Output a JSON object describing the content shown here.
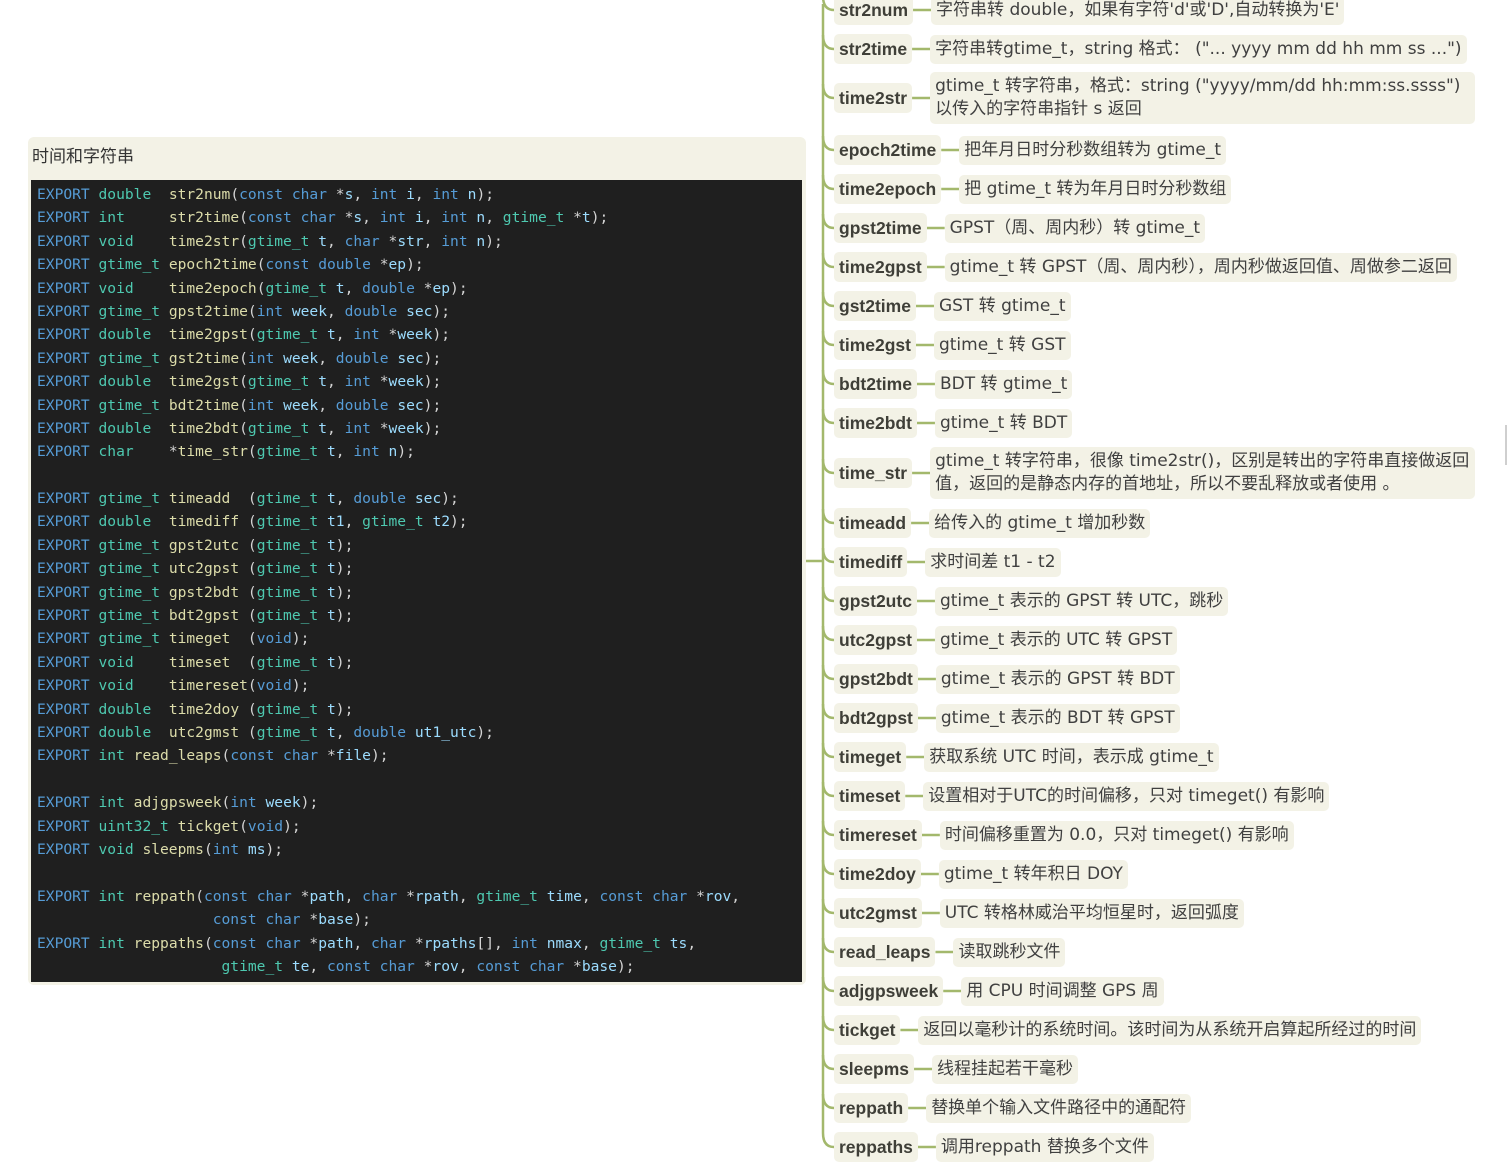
{
  "topic": {
    "title": "时间和字符串",
    "code_lines": [
      [
        [
          "kw",
          "EXPORT "
        ],
        [
          "ty",
          "double  "
        ],
        [
          "fn",
          "str2num"
        ],
        [
          "pu",
          "("
        ],
        [
          "kw",
          "const char "
        ],
        [
          "pu",
          "*"
        ],
        [
          "pa",
          "s"
        ],
        [
          "pu",
          ", "
        ],
        [
          "kw",
          "int "
        ],
        [
          "pa",
          "i"
        ],
        [
          "pu",
          ", "
        ],
        [
          "kw",
          "int "
        ],
        [
          "pa",
          "n"
        ],
        [
          "pu",
          ");"
        ]
      ],
      [
        [
          "kw",
          "EXPORT "
        ],
        [
          "ty",
          "int     "
        ],
        [
          "fn",
          "str2time"
        ],
        [
          "pu",
          "("
        ],
        [
          "kw",
          "const char "
        ],
        [
          "pu",
          "*"
        ],
        [
          "pa",
          "s"
        ],
        [
          "pu",
          ", "
        ],
        [
          "kw",
          "int "
        ],
        [
          "pa",
          "i"
        ],
        [
          "pu",
          ", "
        ],
        [
          "kw",
          "int "
        ],
        [
          "pa",
          "n"
        ],
        [
          "pu",
          ", "
        ],
        [
          "ty",
          "gtime_t "
        ],
        [
          "pu",
          "*"
        ],
        [
          "pa",
          "t"
        ],
        [
          "pu",
          ");"
        ]
      ],
      [
        [
          "kw",
          "EXPORT "
        ],
        [
          "ty",
          "void    "
        ],
        [
          "fn",
          "time2str"
        ],
        [
          "pu",
          "("
        ],
        [
          "ty",
          "gtime_t "
        ],
        [
          "pa",
          "t"
        ],
        [
          "pu",
          ", "
        ],
        [
          "kw",
          "char "
        ],
        [
          "pu",
          "*"
        ],
        [
          "pa",
          "str"
        ],
        [
          "pu",
          ", "
        ],
        [
          "kw",
          "int "
        ],
        [
          "pa",
          "n"
        ],
        [
          "pu",
          ");"
        ]
      ],
      [
        [
          "kw",
          "EXPORT "
        ],
        [
          "ty",
          "gtime_t "
        ],
        [
          "fn",
          "epoch2time"
        ],
        [
          "pu",
          "("
        ],
        [
          "kw",
          "const double "
        ],
        [
          "pu",
          "*"
        ],
        [
          "pa",
          "ep"
        ],
        [
          "pu",
          ");"
        ]
      ],
      [
        [
          "kw",
          "EXPORT "
        ],
        [
          "ty",
          "void    "
        ],
        [
          "fn",
          "time2epoch"
        ],
        [
          "pu",
          "("
        ],
        [
          "ty",
          "gtime_t "
        ],
        [
          "pa",
          "t"
        ],
        [
          "pu",
          ", "
        ],
        [
          "kw",
          "double "
        ],
        [
          "pu",
          "*"
        ],
        [
          "pa",
          "ep"
        ],
        [
          "pu",
          ");"
        ]
      ],
      [
        [
          "kw",
          "EXPORT "
        ],
        [
          "ty",
          "gtime_t "
        ],
        [
          "fn",
          "gpst2time"
        ],
        [
          "pu",
          "("
        ],
        [
          "kw",
          "int "
        ],
        [
          "pa",
          "week"
        ],
        [
          "pu",
          ", "
        ],
        [
          "kw",
          "double "
        ],
        [
          "pa",
          "sec"
        ],
        [
          "pu",
          ");"
        ]
      ],
      [
        [
          "kw",
          "EXPORT "
        ],
        [
          "ty",
          "double  "
        ],
        [
          "fn",
          "time2gpst"
        ],
        [
          "pu",
          "("
        ],
        [
          "ty",
          "gtime_t "
        ],
        [
          "pa",
          "t"
        ],
        [
          "pu",
          ", "
        ],
        [
          "kw",
          "int "
        ],
        [
          "pu",
          "*"
        ],
        [
          "pa",
          "week"
        ],
        [
          "pu",
          ");"
        ]
      ],
      [
        [
          "kw",
          "EXPORT "
        ],
        [
          "ty",
          "gtime_t "
        ],
        [
          "fn",
          "gst2time"
        ],
        [
          "pu",
          "("
        ],
        [
          "kw",
          "int "
        ],
        [
          "pa",
          "week"
        ],
        [
          "pu",
          ", "
        ],
        [
          "kw",
          "double "
        ],
        [
          "pa",
          "sec"
        ],
        [
          "pu",
          ");"
        ]
      ],
      [
        [
          "kw",
          "EXPORT "
        ],
        [
          "ty",
          "double  "
        ],
        [
          "fn",
          "time2gst"
        ],
        [
          "pu",
          "("
        ],
        [
          "ty",
          "gtime_t "
        ],
        [
          "pa",
          "t"
        ],
        [
          "pu",
          ", "
        ],
        [
          "kw",
          "int "
        ],
        [
          "pu",
          "*"
        ],
        [
          "pa",
          "week"
        ],
        [
          "pu",
          ");"
        ]
      ],
      [
        [
          "kw",
          "EXPORT "
        ],
        [
          "ty",
          "gtime_t "
        ],
        [
          "fn",
          "bdt2time"
        ],
        [
          "pu",
          "("
        ],
        [
          "kw",
          "int "
        ],
        [
          "pa",
          "week"
        ],
        [
          "pu",
          ", "
        ],
        [
          "kw",
          "double "
        ],
        [
          "pa",
          "sec"
        ],
        [
          "pu",
          ");"
        ]
      ],
      [
        [
          "kw",
          "EXPORT "
        ],
        [
          "ty",
          "double  "
        ],
        [
          "fn",
          "time2bdt"
        ],
        [
          "pu",
          "("
        ],
        [
          "ty",
          "gtime_t "
        ],
        [
          "pa",
          "t"
        ],
        [
          "pu",
          ", "
        ],
        [
          "kw",
          "int "
        ],
        [
          "pu",
          "*"
        ],
        [
          "pa",
          "week"
        ],
        [
          "pu",
          ");"
        ]
      ],
      [
        [
          "kw",
          "EXPORT "
        ],
        [
          "ty",
          "char    "
        ],
        [
          "pu",
          "*"
        ],
        [
          "fn",
          "time_str"
        ],
        [
          "pu",
          "("
        ],
        [
          "ty",
          "gtime_t "
        ],
        [
          "pa",
          "t"
        ],
        [
          "pu",
          ", "
        ],
        [
          "kw",
          "int "
        ],
        [
          "pa",
          "n"
        ],
        [
          "pu",
          ");"
        ]
      ],
      [],
      [
        [
          "kw",
          "EXPORT "
        ],
        [
          "ty",
          "gtime_t "
        ],
        [
          "fn",
          "timeadd  "
        ],
        [
          "pu",
          "("
        ],
        [
          "ty",
          "gtime_t "
        ],
        [
          "pa",
          "t"
        ],
        [
          "pu",
          ", "
        ],
        [
          "kw",
          "double "
        ],
        [
          "pa",
          "sec"
        ],
        [
          "pu",
          ");"
        ]
      ],
      [
        [
          "kw",
          "EXPORT "
        ],
        [
          "ty",
          "double  "
        ],
        [
          "fn",
          "timediff "
        ],
        [
          "pu",
          "("
        ],
        [
          "ty",
          "gtime_t "
        ],
        [
          "pa",
          "t1"
        ],
        [
          "pu",
          ", "
        ],
        [
          "ty",
          "gtime_t "
        ],
        [
          "pa",
          "t2"
        ],
        [
          "pu",
          ");"
        ]
      ],
      [
        [
          "kw",
          "EXPORT "
        ],
        [
          "ty",
          "gtime_t "
        ],
        [
          "fn",
          "gpst2utc "
        ],
        [
          "pu",
          "("
        ],
        [
          "ty",
          "gtime_t "
        ],
        [
          "pa",
          "t"
        ],
        [
          "pu",
          ");"
        ]
      ],
      [
        [
          "kw",
          "EXPORT "
        ],
        [
          "ty",
          "gtime_t "
        ],
        [
          "fn",
          "utc2gpst "
        ],
        [
          "pu",
          "("
        ],
        [
          "ty",
          "gtime_t "
        ],
        [
          "pa",
          "t"
        ],
        [
          "pu",
          ");"
        ]
      ],
      [
        [
          "kw",
          "EXPORT "
        ],
        [
          "ty",
          "gtime_t "
        ],
        [
          "fn",
          "gpst2bdt "
        ],
        [
          "pu",
          "("
        ],
        [
          "ty",
          "gtime_t "
        ],
        [
          "pa",
          "t"
        ],
        [
          "pu",
          ");"
        ]
      ],
      [
        [
          "kw",
          "EXPORT "
        ],
        [
          "ty",
          "gtime_t "
        ],
        [
          "fn",
          "bdt2gpst "
        ],
        [
          "pu",
          "("
        ],
        [
          "ty",
          "gtime_t "
        ],
        [
          "pa",
          "t"
        ],
        [
          "pu",
          ");"
        ]
      ],
      [
        [
          "kw",
          "EXPORT "
        ],
        [
          "ty",
          "gtime_t "
        ],
        [
          "fn",
          "timeget  "
        ],
        [
          "pu",
          "("
        ],
        [
          "kw",
          "void"
        ],
        [
          "pu",
          ");"
        ]
      ],
      [
        [
          "kw",
          "EXPORT "
        ],
        [
          "ty",
          "void    "
        ],
        [
          "fn",
          "timeset  "
        ],
        [
          "pu",
          "("
        ],
        [
          "ty",
          "gtime_t "
        ],
        [
          "pa",
          "t"
        ],
        [
          "pu",
          ");"
        ]
      ],
      [
        [
          "kw",
          "EXPORT "
        ],
        [
          "ty",
          "void    "
        ],
        [
          "fn",
          "timereset"
        ],
        [
          "pu",
          "("
        ],
        [
          "kw",
          "void"
        ],
        [
          "pu",
          ");"
        ]
      ],
      [
        [
          "kw",
          "EXPORT "
        ],
        [
          "ty",
          "double  "
        ],
        [
          "fn",
          "time2doy "
        ],
        [
          "pu",
          "("
        ],
        [
          "ty",
          "gtime_t "
        ],
        [
          "pa",
          "t"
        ],
        [
          "pu",
          ");"
        ]
      ],
      [
        [
          "kw",
          "EXPORT "
        ],
        [
          "ty",
          "double  "
        ],
        [
          "fn",
          "utc2gmst "
        ],
        [
          "pu",
          "("
        ],
        [
          "ty",
          "gtime_t "
        ],
        [
          "pa",
          "t"
        ],
        [
          "pu",
          ", "
        ],
        [
          "kw",
          "double "
        ],
        [
          "pa",
          "ut1_utc"
        ],
        [
          "pu",
          ");"
        ]
      ],
      [
        [
          "kw",
          "EXPORT "
        ],
        [
          "ty",
          "int "
        ],
        [
          "fn",
          "read_leaps"
        ],
        [
          "pu",
          "("
        ],
        [
          "kw",
          "const char "
        ],
        [
          "pu",
          "*"
        ],
        [
          "pa",
          "file"
        ],
        [
          "pu",
          ");"
        ]
      ],
      [],
      [
        [
          "kw",
          "EXPORT "
        ],
        [
          "ty",
          "int "
        ],
        [
          "fn",
          "adjgpsweek"
        ],
        [
          "pu",
          "("
        ],
        [
          "kw",
          "int "
        ],
        [
          "pa",
          "week"
        ],
        [
          "pu",
          ");"
        ]
      ],
      [
        [
          "kw",
          "EXPORT "
        ],
        [
          "ty",
          "uint32_t "
        ],
        [
          "fn",
          "tickget"
        ],
        [
          "pu",
          "("
        ],
        [
          "kw",
          "void"
        ],
        [
          "pu",
          ");"
        ]
      ],
      [
        [
          "kw",
          "EXPORT "
        ],
        [
          "ty",
          "void "
        ],
        [
          "fn",
          "sleepms"
        ],
        [
          "pu",
          "("
        ],
        [
          "kw",
          "int "
        ],
        [
          "pa",
          "ms"
        ],
        [
          "pu",
          ");"
        ]
      ],
      [],
      [
        [
          "kw",
          "EXPORT "
        ],
        [
          "ty",
          "int "
        ],
        [
          "fn",
          "reppath"
        ],
        [
          "pu",
          "("
        ],
        [
          "kw",
          "const char "
        ],
        [
          "pu",
          "*"
        ],
        [
          "pa",
          "path"
        ],
        [
          "pu",
          ", "
        ],
        [
          "kw",
          "char "
        ],
        [
          "pu",
          "*"
        ],
        [
          "pa",
          "rpath"
        ],
        [
          "pu",
          ", "
        ],
        [
          "ty",
          "gtime_t "
        ],
        [
          "pa",
          "time"
        ],
        [
          "pu",
          ", "
        ],
        [
          "kw",
          "const char "
        ],
        [
          "pu",
          "*"
        ],
        [
          "pa",
          "rov"
        ],
        [
          "pu",
          ","
        ]
      ],
      [
        [
          "pl",
          "                    "
        ],
        [
          "kw",
          "const char "
        ],
        [
          "pu",
          "*"
        ],
        [
          "pa",
          "base"
        ],
        [
          "pu",
          ");"
        ]
      ],
      [
        [
          "kw",
          "EXPORT "
        ],
        [
          "ty",
          "int "
        ],
        [
          "fn",
          "reppaths"
        ],
        [
          "pu",
          "("
        ],
        [
          "kw",
          "const char "
        ],
        [
          "pu",
          "*"
        ],
        [
          "pa",
          "path"
        ],
        [
          "pu",
          ", "
        ],
        [
          "kw",
          "char "
        ],
        [
          "pu",
          "*"
        ],
        [
          "pa",
          "rpaths"
        ],
        [
          "pu",
          "[], "
        ],
        [
          "kw",
          "int "
        ],
        [
          "pa",
          "nmax"
        ],
        [
          "pu",
          ", "
        ],
        [
          "ty",
          "gtime_t "
        ],
        [
          "pa",
          "ts"
        ],
        [
          "pu",
          ","
        ]
      ],
      [
        [
          "pl",
          "                     "
        ],
        [
          "ty",
          "gtime_t "
        ],
        [
          "pa",
          "te"
        ],
        [
          "pu",
          ", "
        ],
        [
          "kw",
          "const char "
        ],
        [
          "pu",
          "*"
        ],
        [
          "pa",
          "rov"
        ],
        [
          "pu",
          ", "
        ],
        [
          "kw",
          "const char "
        ],
        [
          "pu",
          "*"
        ],
        [
          "pa",
          "base"
        ],
        [
          "pu",
          ");"
        ]
      ]
    ]
  },
  "branches": [
    {
      "name": "str2num",
      "desc": "字符串转 double，如果有字符'd'或'D',自动转换为'E'"
    },
    {
      "name": "str2time",
      "desc": "字符串转gtime_t，string 格式： (\"... yyyy mm dd hh mm ss ...\")"
    },
    {
      "name": "time2str",
      "desc": "gtime_t 转字符串，格式：string (\"yyyy/mm/dd hh:mm:ss.ssss\") 以传入的字符串指针 s 返回"
    },
    {
      "name": "epoch2time",
      "desc": "把年月日时分秒数组转为 gtime_t"
    },
    {
      "name": "time2epoch",
      "desc": "把 gtime_t 转为年月日时分秒数组"
    },
    {
      "name": "gpst2time",
      "desc": "GPST（周、周内秒）转 gtime_t"
    },
    {
      "name": "time2gpst",
      "desc": "gtime_t 转 GPST（周、周内秒），周内秒做返回值、周做参二返回"
    },
    {
      "name": "gst2time",
      "desc": "GST 转 gtime_t"
    },
    {
      "name": "time2gst",
      "desc": "gtime_t 转 GST"
    },
    {
      "name": "bdt2time",
      "desc": "BDT 转 gtime_t"
    },
    {
      "name": "time2bdt",
      "desc": "gtime_t 转 BDT"
    },
    {
      "name": "time_str",
      "desc": "gtime_t 转字符串，很像 time2str()，区别是转出的字符串直接做返回值，返回的是静态内存的首地址，所以不要乱释放或者使用 。"
    },
    {
      "name": "timeadd",
      "desc": "给传入的 gtime_t 增加秒数"
    },
    {
      "name": "timediff",
      "desc": "求时间差 t1 - t2"
    },
    {
      "name": "gpst2utc",
      "desc": "gtime_t 表示的 GPST 转 UTC，跳秒"
    },
    {
      "name": "utc2gpst",
      "desc": "gtime_t 表示的 UTC 转 GPST"
    },
    {
      "name": "gpst2bdt",
      "desc": "gtime_t 表示的 GPST 转 BDT"
    },
    {
      "name": "bdt2gpst",
      "desc": "gtime_t 表示的 BDT 转 GPST"
    },
    {
      "name": "timeget",
      "desc": "获取系统 UTC 时间，表示成 gtime_t"
    },
    {
      "name": "timeset",
      "desc": "设置相对于UTC的时间偏移，只对 timeget() 有影响"
    },
    {
      "name": "timereset",
      "desc": "时间偏移重置为 0.0，只对 timeget() 有影响"
    },
    {
      "name": "time2doy",
      "desc": "gtime_t 转年积日 DOY"
    },
    {
      "name": "utc2gmst",
      "desc": "UTC 转格林威治平均恒星时，返回弧度"
    },
    {
      "name": "read_leaps",
      "desc": "读取跳秒文件"
    },
    {
      "name": "adjgpsweek",
      "desc": "用 CPU 时间调整 GPS 周"
    },
    {
      "name": "tickget",
      "desc": "返回以毫秒计的系统时间。该时间为从系统开启算起所经过的时间"
    },
    {
      "name": "sleepms",
      "desc": "线程挂起若干毫秒"
    },
    {
      "name": "reppath",
      "desc": "替换单个输入文件路径中的通配符"
    },
    {
      "name": "reppaths",
      "desc": "调用reppath 替换多个文件"
    }
  ],
  "colors": {
    "connector": "#a3b86c",
    "card": "#f3f2e6",
    "code_bg": "#1f1f1f"
  }
}
